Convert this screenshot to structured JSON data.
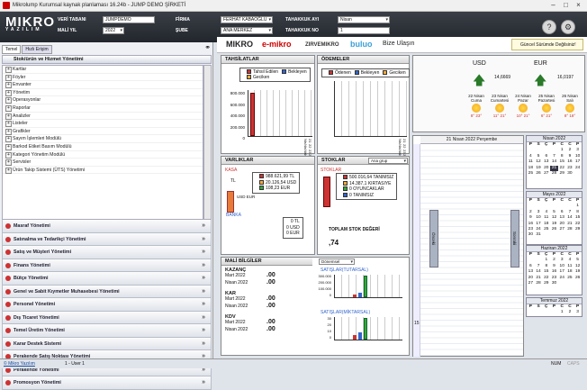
{
  "window": {
    "title": "Mikrolump Kurumsal kaynak planlaması 16.24b - JUMP DEMO ŞİRKETİ"
  },
  "header": {
    "logo": "MIKRO",
    "logo_sub": "YAZILIM",
    "veri_tabani_label": "VERİ TABANI",
    "veri_tabani": "JUMPDEMO",
    "mali_yil_label": "MALİ YIL",
    "mali_yil": "2022",
    "firma_label": "FİRMA",
    "firma": "FERHAT KABAOĞLU",
    "sube_label": "ŞUBE",
    "sube": "ANA MERKEZ",
    "tahakkuk_ayi_label": "TAHAKKUK AYI",
    "tahakkuk_ayi": "Nisan",
    "tahakkuk_no_label": "TAHAKKUK NO",
    "tahakkuk_no": "1"
  },
  "left": {
    "tabs": [
      "Temel",
      "Hızlı Erişim"
    ],
    "tree_title": "Stok/ürün ve Hizmet Yönetimi",
    "tree_items": [
      "Kartlar",
      "Föyler",
      "Envanter",
      "Yönetim",
      "Operasyonlar",
      "Raporlar",
      "Analizler",
      "Listeler",
      "Grafikler",
      "Sayım İşlemleri Modülü",
      "Barkod Etiket Basım Modülü",
      "Kategori Yönetim Modülü",
      "Servisler",
      "Ürün Takip Sistemi (ÜTS) Yönetimi"
    ],
    "groups": [
      "Masraf Yönetimi",
      "Satınalma ve Tedarikçi Yönetimi",
      "Satış ve Müşteri Yönetimi",
      "Finans Yönetimi",
      "Bütçe Yönetimi",
      "Genel ve Sabit Kıymetler Muhasebesi Yönetimi",
      "Personel Yönetimi",
      "Dış Ticaret Yönetimi",
      "Temel Üretim Yönetimi",
      "Karar Destek Sistemi",
      "Perakende Satış Noktası Yönetimi",
      "Perakende Yönetimi",
      "Promosyon Yönetimi"
    ]
  },
  "brands": {
    "mikro": "MIKRO",
    "emikro": "e-mikro",
    "zirve": "ZIRVEMIKRO",
    "buluo": "buluo",
    "bize_ulasin": "Bize Ulaşın",
    "update": "Güncel Sürümde Değilsiniz!"
  },
  "tahsilatlar": {
    "title": "TAHSİLATLAR",
    "legend": [
      "Tahsil Edilen",
      "Bekleyen",
      "Geciken"
    ],
    "yticks": [
      "800.000",
      "600.000",
      "400.000",
      "200.000",
      "0"
    ],
    "xlabels": [
      "21 Nis",
      "22 Nis",
      "23 Nis",
      "24 Nis",
      "25 Nis",
      "26 Nis",
      "27 Nis",
      "28 Nis",
      "29 Nis",
      "30 Nis"
    ]
  },
  "odemeler": {
    "title": "ÖDEMELER",
    "legend": [
      "Ödenen",
      "Bekleyen",
      "Geciken"
    ],
    "xlabels": [
      "21 Nis",
      "22 Nis",
      "23 Nis",
      "24 Nis",
      "25 Nis",
      "26 Nis",
      "27 Nis",
      "28 Nis",
      "29 Nis",
      "30 Nis"
    ]
  },
  "varliklar": {
    "title": "VARLIKLAR",
    "kasa": "KASA",
    "banka": "BANKA",
    "tl": "TL",
    "usd_eur": "USD EUR",
    "kasa_vals": [
      "988.621,99 TL",
      "20.126,54 USD",
      "108,23 EUR"
    ],
    "banka_vals": [
      "0 TL",
      "0 USD",
      "0 EUR"
    ]
  },
  "stoklar": {
    "title": "STOKLAR",
    "group_label": "Ana grup",
    "stoklar_label": "STOKLAR",
    "rows": [
      "500.016,64 TANIMSIZ",
      "14.387,1 KIRTASIYE",
      "0 OYUNCAKLAR",
      "0 TANIMSIZ"
    ],
    "toplam_label": "TOPLAM STOK DEĞERİ",
    "toplam": ",74"
  },
  "mali": {
    "title": "MALİ BİLGİLER",
    "sections": [
      {
        "name": "KAZANÇ",
        "rows": [
          {
            "m": "Mart 2022",
            "v": ".00"
          },
          {
            "m": "Nisan 2022",
            "v": ".00"
          }
        ]
      },
      {
        "name": "KAR",
        "rows": [
          {
            "m": "Mart 2022",
            "v": ".00"
          },
          {
            "m": "Nisan 2022",
            "v": ".00"
          }
        ]
      },
      {
        "name": "KDV",
        "rows": [
          {
            "m": "Mart 2022",
            "v": ".00"
          },
          {
            "m": "Nisan 2022",
            "v": ".00"
          }
        ]
      }
    ],
    "period": "Dönemsel",
    "chart1_title": "SATIŞLAR(TUTARSAL)",
    "chart1_yticks": [
      "300.000",
      "200.000",
      "100.000",
      "0"
    ],
    "chart2_title": "SATIŞLAR(MİKTARSAL)",
    "chart2_yticks": [
      "30",
      "20",
      "10",
      "0"
    ]
  },
  "currency": {
    "usd_label": "USD",
    "usd_value": "14,6669",
    "eur_label": "EUR",
    "eur_value": "16,0197",
    "days": [
      {
        "d": "22 Nisan",
        "w": "Cuma",
        "t": "8° 23°"
      },
      {
        "d": "23 Nisan",
        "w": "Cumartesi",
        "t": "11° 21°"
      },
      {
        "d": "24 Nisan",
        "w": "Pazar",
        "t": "10° 21°"
      },
      {
        "d": "25 Nisan",
        "w": "Pazartesi",
        "t": "6° 21°"
      },
      {
        "d": "26 Nisan",
        "w": "Salı",
        "t": "8° 18°"
      }
    ]
  },
  "agenda": {
    "date": "21 Nisan 2022 Perşembe",
    "time_label": "15",
    "bottom_label": "Önceki",
    "next_label": "Sonraki"
  },
  "calendars": [
    {
      "title": "Nisan 2022",
      "days": [
        "",
        "",
        "",
        "",
        "1",
        "2",
        "3",
        "4",
        "5",
        "6",
        "7",
        "8",
        "9",
        "10",
        "11",
        "12",
        "13",
        "14",
        "15",
        "16",
        "17",
        "18",
        "19",
        "20",
        "21",
        "22",
        "23",
        "24",
        "25",
        "26",
        "27",
        "28",
        "29",
        "30",
        "",
        ""
      ],
      "pre": [
        "28",
        "29",
        "30",
        "31"
      ]
    },
    {
      "title": "Mayıs 2022",
      "days": [
        "",
        "",
        "",
        "",
        "",
        "",
        "1",
        "2",
        "3",
        "4",
        "5",
        "6",
        "7",
        "8",
        "9",
        "10",
        "11",
        "12",
        "13",
        "14",
        "15",
        "16",
        "17",
        "18",
        "19",
        "20",
        "21",
        "22",
        "23",
        "24",
        "25",
        "26",
        "27",
        "28",
        "29",
        "30",
        "31"
      ]
    },
    {
      "title": "Haziran 2022",
      "days": [
        "",
        "",
        "1",
        "2",
        "3",
        "4",
        "5",
        "6",
        "7",
        "8",
        "9",
        "10",
        "11",
        "12",
        "13",
        "14",
        "15",
        "16",
        "17",
        "18",
        "19",
        "20",
        "21",
        "22",
        "23",
        "24",
        "25",
        "26",
        "27",
        "28",
        "29",
        "30"
      ]
    },
    {
      "title": "Temmuz 2022",
      "days": [
        "",
        "",
        "",
        "",
        "1",
        "2",
        "3"
      ]
    }
  ],
  "cal_header": [
    "P",
    "S",
    "Ç",
    "P",
    "C",
    "C",
    "P"
  ],
  "status": {
    "link": "© Mikro Yazılım",
    "user": "1 - User 1",
    "num": "NUM",
    "caps": "CAPS"
  }
}
